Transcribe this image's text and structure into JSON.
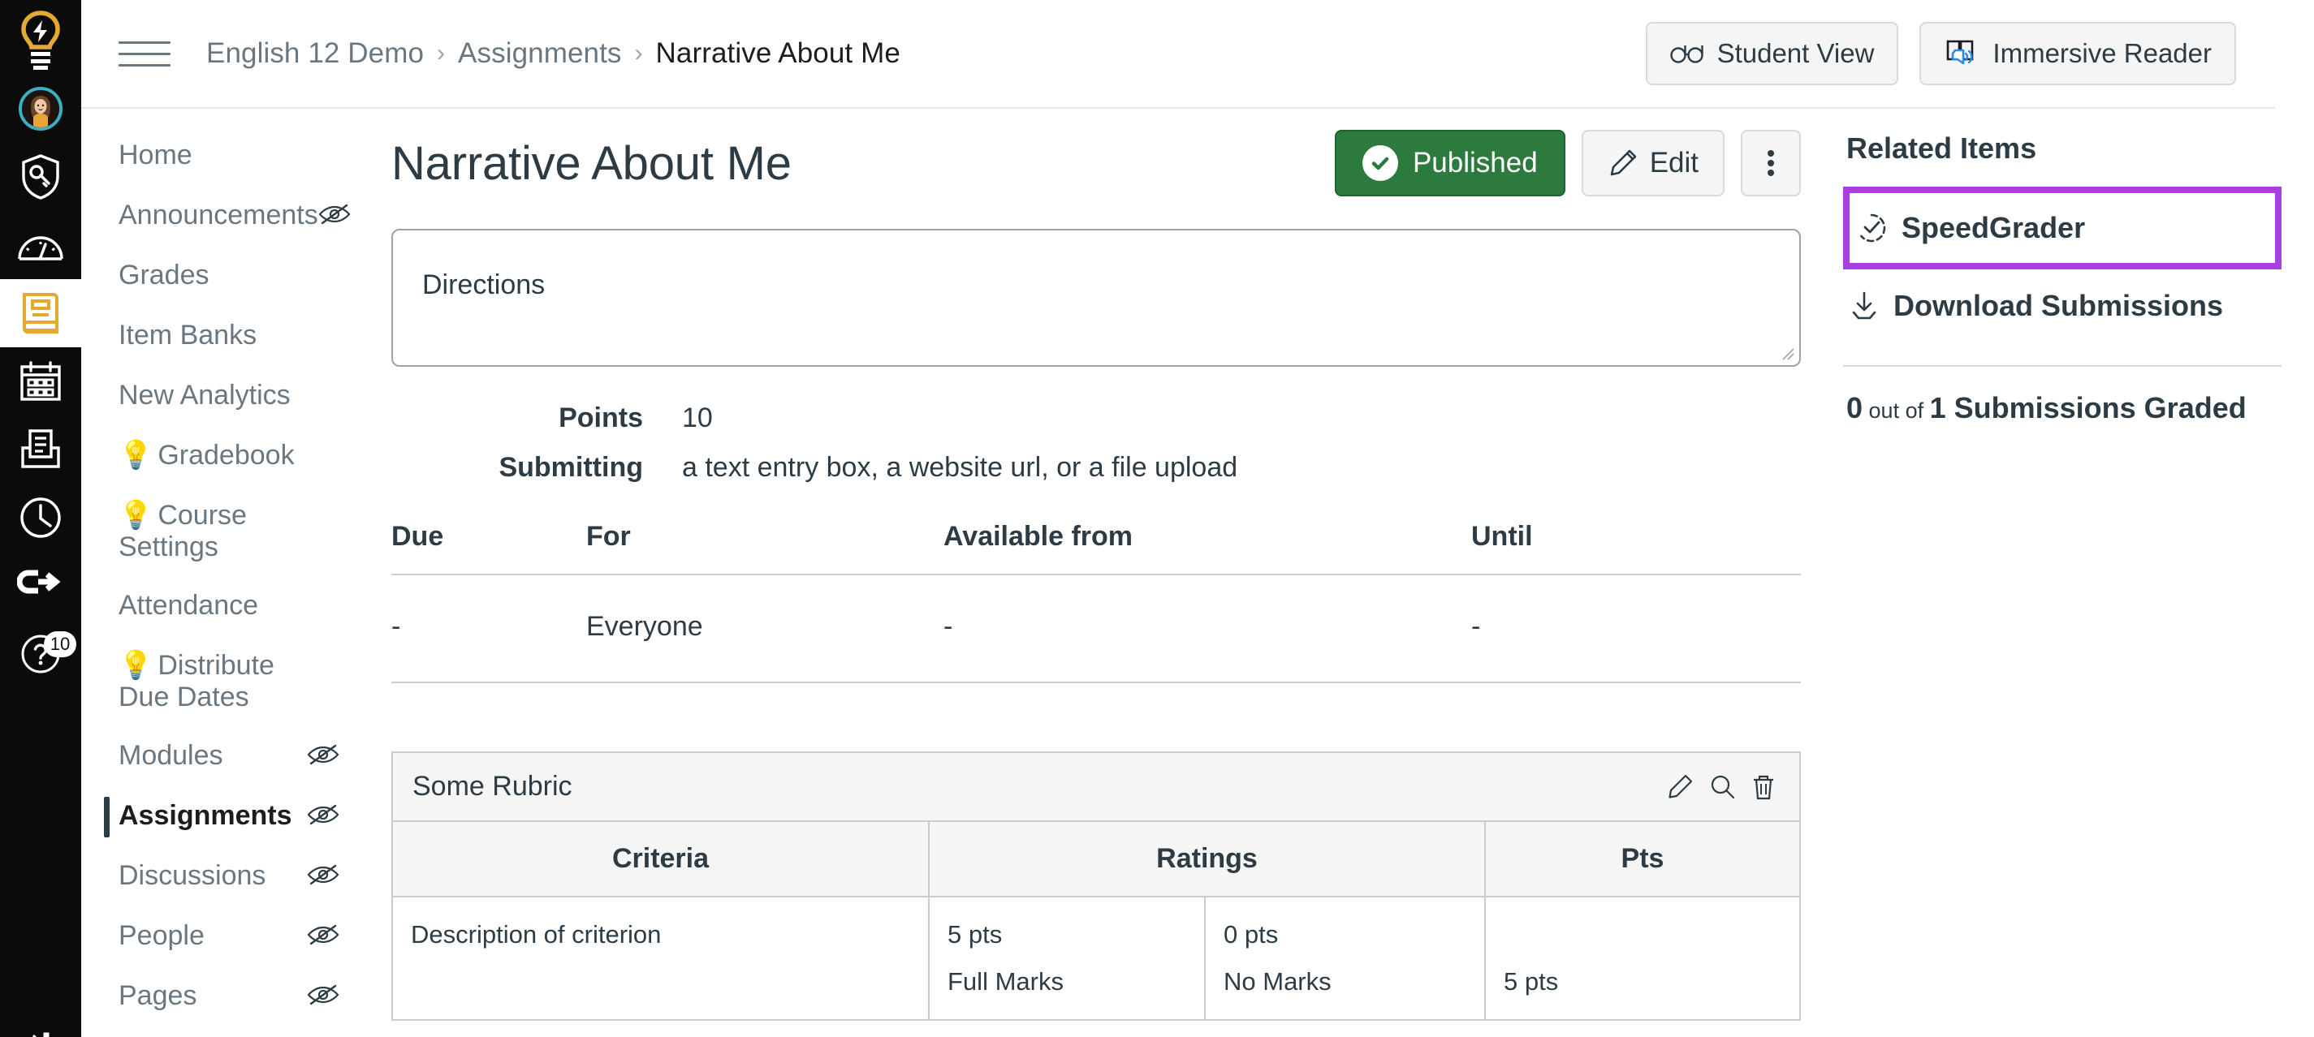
{
  "global_nav": {
    "items": [
      {
        "name": "canvas-logo-icon",
        "icon": "lightbulb-logo",
        "label": "Dashboard Logo",
        "active": false
      },
      {
        "name": "account-avatar",
        "icon": "avatar",
        "label": "Account",
        "active": false
      },
      {
        "name": "admin-icon",
        "icon": "shield-key",
        "label": "Admin",
        "active": false
      },
      {
        "name": "dashboard-icon",
        "icon": "gauge",
        "label": "Dashboard",
        "active": false
      },
      {
        "name": "courses-icon",
        "icon": "book",
        "label": "Courses",
        "active": true
      },
      {
        "name": "calendar-icon",
        "icon": "calendar",
        "label": "Calendar",
        "active": false
      },
      {
        "name": "inbox-icon",
        "icon": "inbox",
        "label": "Inbox",
        "active": false
      },
      {
        "name": "history-icon",
        "icon": "clock",
        "label": "History",
        "active": false
      },
      {
        "name": "logout-icon",
        "icon": "logout-arrow",
        "label": "Logout",
        "active": false
      },
      {
        "name": "help-icon",
        "icon": "question-circle",
        "label": "Help",
        "active": false,
        "badge": "10"
      }
    ]
  },
  "topbar": {
    "menu_label": "Menu",
    "breadcrumbs": [
      "English 12 Demo",
      "Assignments",
      "Narrative About Me"
    ],
    "separator": "›",
    "buttons": [
      {
        "name": "student-view-button",
        "icon": "glasses-icon",
        "label": "Student View"
      },
      {
        "name": "immersive-reader-button",
        "icon": "immersive-reader-icon",
        "label": "Immersive Reader"
      }
    ]
  },
  "course_nav": {
    "items": [
      {
        "label": "Home",
        "hidden_icon": false,
        "bulb": false,
        "active": false
      },
      {
        "label": "Announcements",
        "hidden_icon": true,
        "bulb": false,
        "active": false
      },
      {
        "label": "Grades",
        "hidden_icon": false,
        "bulb": false,
        "active": false
      },
      {
        "label": "Item Banks",
        "hidden_icon": false,
        "bulb": false,
        "active": false
      },
      {
        "label": "New Analytics",
        "hidden_icon": false,
        "bulb": false,
        "active": false
      },
      {
        "label": "Gradebook",
        "hidden_icon": false,
        "bulb": true,
        "active": false
      },
      {
        "label": "Course Settings",
        "hidden_icon": false,
        "bulb": true,
        "active": false
      },
      {
        "label": "Attendance",
        "hidden_icon": false,
        "bulb": false,
        "active": false
      },
      {
        "label": "Distribute Due Dates",
        "hidden_icon": false,
        "bulb": true,
        "active": false
      },
      {
        "label": "Modules",
        "hidden_icon": true,
        "bulb": false,
        "active": false
      },
      {
        "label": "Assignments",
        "hidden_icon": true,
        "bulb": false,
        "active": true
      },
      {
        "label": "Discussions",
        "hidden_icon": true,
        "bulb": false,
        "active": false
      },
      {
        "label": "People",
        "hidden_icon": true,
        "bulb": false,
        "active": false
      },
      {
        "label": "Pages",
        "hidden_icon": true,
        "bulb": false,
        "active": false
      }
    ],
    "bulb_glyph": "💡"
  },
  "assignment": {
    "title": "Narrative About Me",
    "publish_button": "Published",
    "edit_button": "Edit",
    "more_button": "More options",
    "description": "Directions",
    "points_label": "Points",
    "points_value": "10",
    "submitting_label": "Submitting",
    "submitting_value": "a text entry box, a website url, or a file upload"
  },
  "due_table": {
    "headers": [
      "Due",
      "For",
      "Available from",
      "Until"
    ],
    "rows": [
      [
        "-",
        "Everyone",
        "-",
        "-"
      ]
    ]
  },
  "rubric": {
    "title": "Some Rubric",
    "icons": [
      {
        "name": "edit-rubric-icon",
        "glyph": "pencil"
      },
      {
        "name": "search-rubric-icon",
        "glyph": "search"
      },
      {
        "name": "delete-rubric-icon",
        "glyph": "trash"
      }
    ],
    "headers": [
      "Criteria",
      "Ratings",
      "Pts"
    ],
    "rows": [
      {
        "criterion": "Description of criterion",
        "ratings": [
          {
            "pts": "5 pts",
            "desc": "Full Marks"
          },
          {
            "pts": "0 pts",
            "desc": "No Marks"
          }
        ],
        "pts": "5 pts"
      }
    ]
  },
  "related_items": {
    "title": "Related Items",
    "items": [
      {
        "name": "speedgrader-link",
        "label": "SpeedGrader",
        "icon": "speedgrader-icon",
        "highlighted": true
      },
      {
        "name": "download-submissions-link",
        "label": "Download Submissions",
        "icon": "download-icon",
        "highlighted": false
      }
    ],
    "graded_count": "0",
    "graded_mid": " out of ",
    "graded_total": "1",
    "graded_suffix": " Submissions Graded"
  },
  "colors": {
    "published_green": "#2d7a3e",
    "highlight_purple": "#a93fe0",
    "nav_black": "#0b0b0b",
    "text_dark": "#2d3b45",
    "text_muted": "#6b7780",
    "brand_yellow": "#e4a932",
    "avatar_ring": "#3ab0c3"
  }
}
